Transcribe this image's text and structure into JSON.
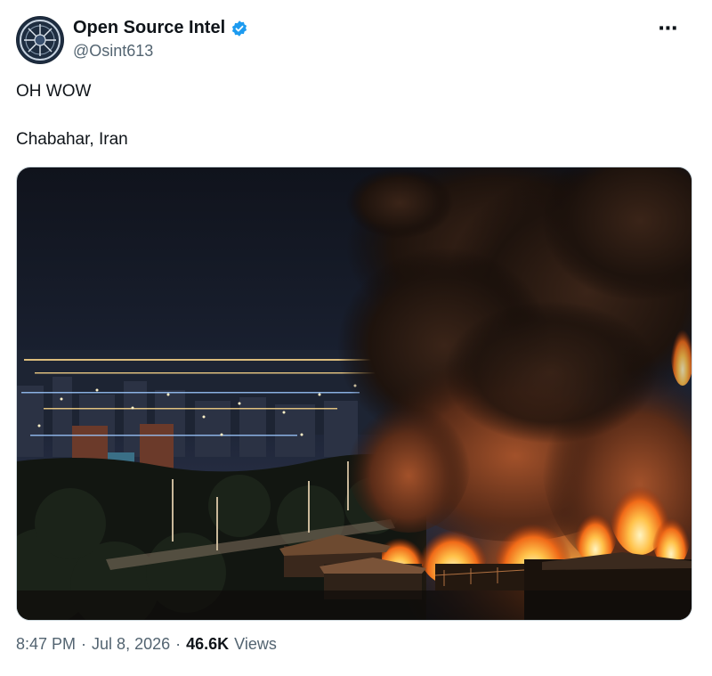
{
  "author": {
    "display_name": "Open Source Intel",
    "handle": "@Osint613",
    "verified": true,
    "verified_color": "#1d9bf0",
    "avatar_icon": "emblem-avatar"
  },
  "more_icon": "⋯",
  "tweet": {
    "lines": [
      "OH WOW",
      "Chabahar, Iran"
    ]
  },
  "media": {
    "type": "photo"
  },
  "meta": {
    "time": "8:47 PM",
    "separator": "·",
    "date": "Jul 8, 2026",
    "views_count": "46.6K",
    "views_label": "Views"
  }
}
